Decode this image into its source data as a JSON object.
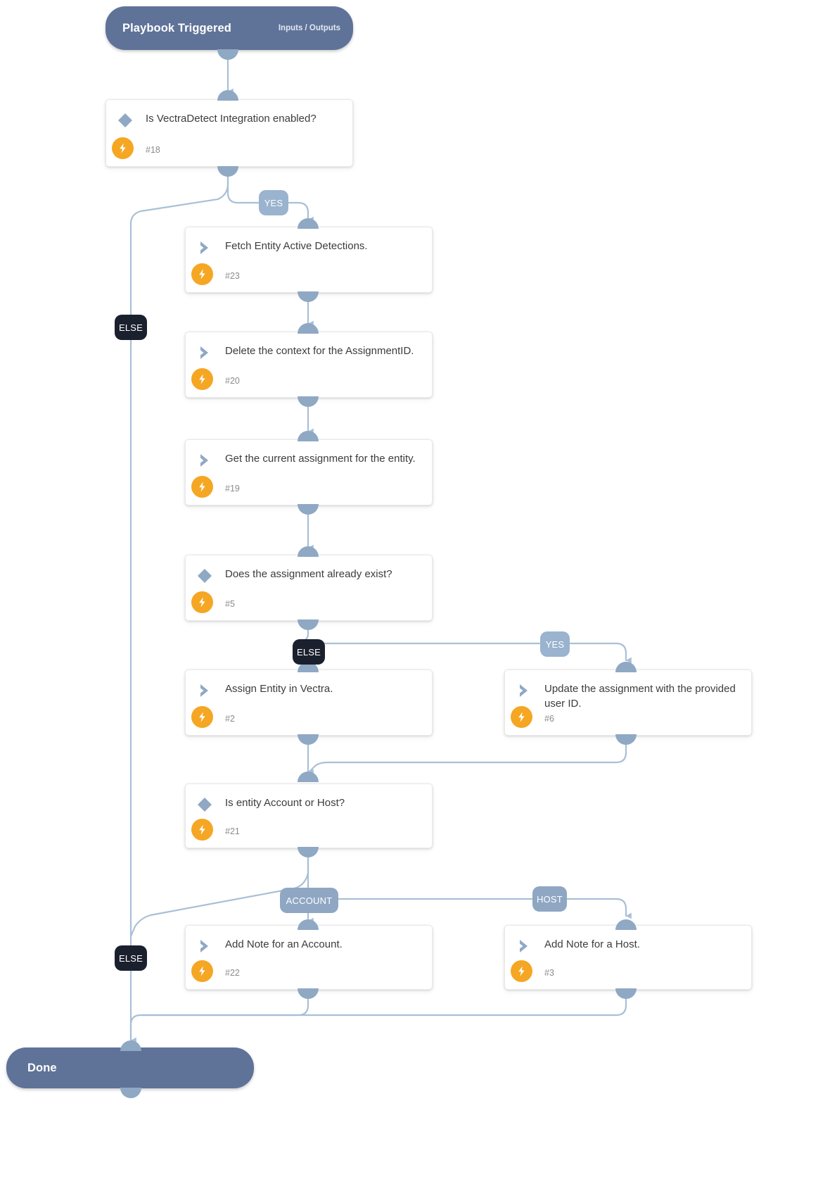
{
  "diagram": {
    "type": "playbook-flowchart",
    "start": {
      "title": "Playbook Triggered",
      "sublabel": "Inputs / Outputs"
    },
    "end": {
      "title": "Done"
    },
    "nodes": [
      {
        "id": "n18",
        "kind": "condition",
        "title": "Is VectraDetect Integration enabled?",
        "number": "#18"
      },
      {
        "id": "n23",
        "kind": "action",
        "title": "Fetch Entity Active Detections.",
        "number": "#23"
      },
      {
        "id": "n20",
        "kind": "action",
        "title": "Delete the context for the AssignmentID.",
        "number": "#20"
      },
      {
        "id": "n19",
        "kind": "action",
        "title": "Get the current assignment for the entity.",
        "number": "#19"
      },
      {
        "id": "n5",
        "kind": "condition",
        "title": "Does the assignment already exist?",
        "number": "#5"
      },
      {
        "id": "n2",
        "kind": "action",
        "title": "Assign Entity in Vectra.",
        "number": "#2"
      },
      {
        "id": "n6",
        "kind": "action",
        "title": "Update the assignment with the provided user ID.",
        "number": "#6"
      },
      {
        "id": "n21",
        "kind": "condition",
        "title": "Is entity Account or Host?",
        "number": "#21"
      },
      {
        "id": "n22",
        "kind": "action",
        "title": "Add Note for an Account.",
        "number": "#22"
      },
      {
        "id": "n3",
        "kind": "action",
        "title": "Add Note for a Host.",
        "number": "#3"
      }
    ],
    "branch_labels": [
      {
        "id": "b1",
        "text": "YES",
        "style": "yes"
      },
      {
        "id": "b2",
        "text": "ELSE",
        "style": "else"
      },
      {
        "id": "b3",
        "text": "ELSE",
        "style": "else"
      },
      {
        "id": "b4",
        "text": "YES",
        "style": "yes"
      },
      {
        "id": "b5",
        "text": "ACCOUNT",
        "style": "opt"
      },
      {
        "id": "b6",
        "text": "HOST",
        "style": "opt"
      },
      {
        "id": "b7",
        "text": "ELSE",
        "style": "else"
      }
    ],
    "icons": {
      "condition": "diamond-icon",
      "action": "chevron-right-icon",
      "badge": "lightning-bolt-icon"
    },
    "colors": {
      "terminal": "#5f7399",
      "edge": "#9fb6cf",
      "port": "#8fa8c4",
      "badge": "#f5a623",
      "branch_yes": "#9ab3ce",
      "branch_else": "#1b202e",
      "branch_option": "#8fa7c3",
      "card_bg": "#ffffff",
      "text": "#3c3c3c"
    }
  }
}
